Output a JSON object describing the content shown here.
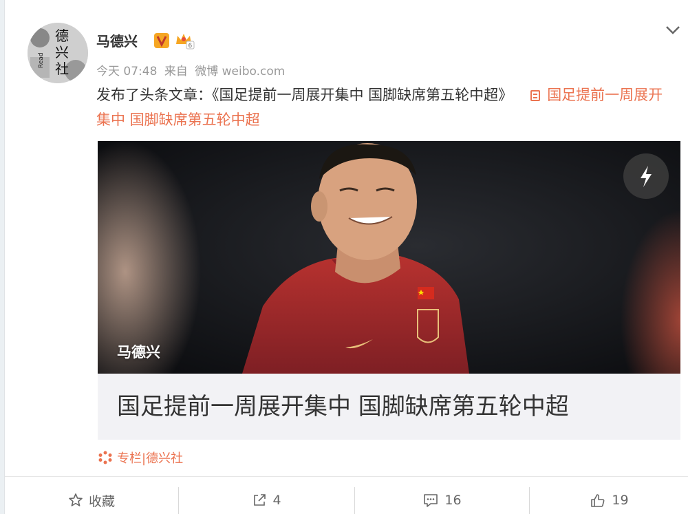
{
  "post": {
    "username": "马德兴",
    "verified_icon": "verified-v-icon",
    "vip_icon": "crown-icon",
    "time": "今天 07:48",
    "source_prefix": "来自",
    "source": "微博 weibo.com",
    "text": "发布了头条文章：《国足提前一周展开集中 国脚缺席第五轮中超》",
    "link_text": "国足提前一周展开集中 国脚缺席第五轮中超"
  },
  "avatar": {
    "lines": [
      "德",
      "兴",
      "社"
    ],
    "side": "Read"
  },
  "article": {
    "photo_caption": "马德兴",
    "title": "国足提前一周展开集中 国脚缺席第五轮中超",
    "flash_icon": "lightning-icon"
  },
  "column": {
    "label": "专栏|德兴社",
    "icon": "snowflake-icon"
  },
  "actions": {
    "favorite": "收藏",
    "repost_count": "4",
    "comment_count": "16",
    "like_count": "19"
  },
  "colors": {
    "accent": "#eb7350",
    "badge": "#f6a623"
  }
}
